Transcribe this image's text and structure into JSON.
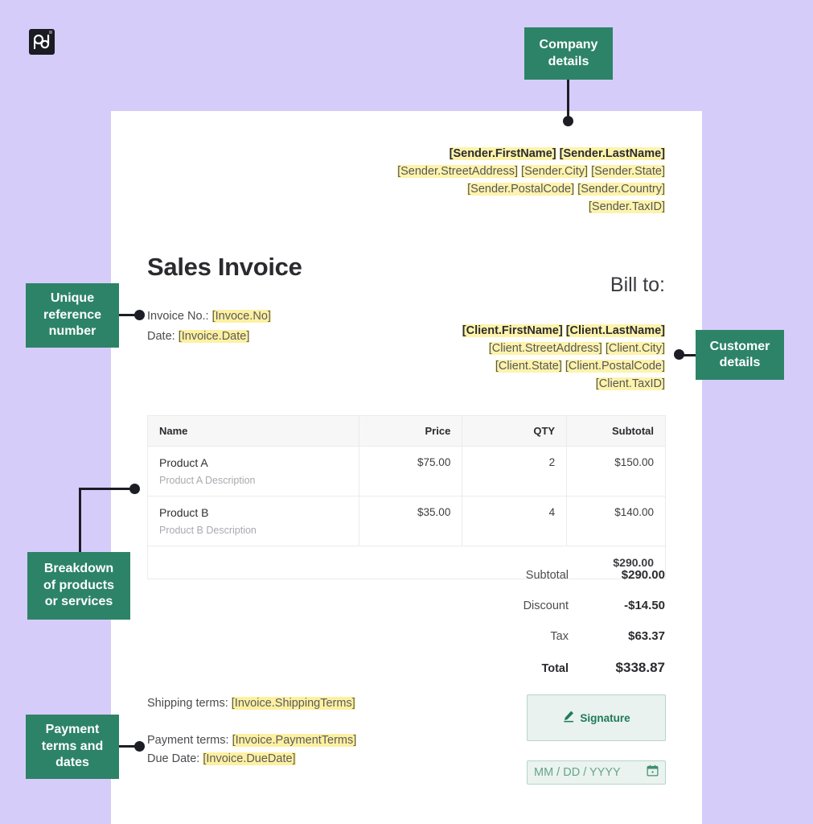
{
  "brand": {
    "logo_name": "pandadoc-logo",
    "background_color": "#d6ccfa",
    "accent_color": "#2d8367",
    "highlight_color": "#fdf3ab"
  },
  "callouts": [
    {
      "id": "company",
      "label": "Company\ndetails",
      "line1": "Company",
      "line2": "details",
      "line3": ""
    },
    {
      "id": "unique",
      "label": "Unique reference number",
      "line1": "Unique",
      "line2": "reference",
      "line3": "number"
    },
    {
      "id": "breakdown",
      "label": "Breakdown of products or services",
      "line1": "Breakdown",
      "line2": "of products",
      "line3": "or services"
    },
    {
      "id": "payment",
      "label": "Payment terms and dates",
      "line1": "Payment",
      "line2": "terms and",
      "line3": "dates"
    },
    {
      "id": "customer",
      "label": "Customer details",
      "line1": "Customer",
      "line2": "details",
      "line3": ""
    }
  ],
  "sender": {
    "name_first": "[Sender.FirstName]",
    "name_last": "[Sender.LastName]",
    "street": "[Sender.StreetAddress]",
    "city": "[Sender.City]",
    "state": "[Sender.State]",
    "postal": "[Sender.PostalCode]",
    "country": "[Sender.Country]",
    "taxid": "[Sender.TaxID]"
  },
  "invoice": {
    "title": "Sales Invoice",
    "number_label": "Invoice No.:",
    "number_value": "[Invoce.No]",
    "date_label": "Date:",
    "date_value": "[Invoice.Date]"
  },
  "bill_to": {
    "heading": "Bill to:",
    "name_first": "[Client.FirstName]",
    "name_last": "[Client.LastName]",
    "street": "[Client.StreetAddress]",
    "city": "[Client.City]",
    "state": "[Client.State]",
    "postal": "[Client.PostalCode]",
    "taxid": "[Client.TaxID]"
  },
  "table": {
    "columns": [
      "Name",
      "Price",
      "QTY",
      "Subtotal"
    ],
    "rows": [
      {
        "name": "Product A",
        "description": "Product A Description",
        "price": "$75.00",
        "qty": "2",
        "subtotal": "$150.00"
      },
      {
        "name": "Product B",
        "description": "Product B Description",
        "price": "$35.00",
        "qty": "4",
        "subtotal": "$140.00"
      }
    ],
    "footer_total": "$290.00"
  },
  "totals": [
    {
      "label": "Subtotal",
      "value": "$290.00"
    },
    {
      "label": "Discount",
      "value": "-$14.50"
    },
    {
      "label": "Tax",
      "value": "$63.37"
    },
    {
      "label": "Total",
      "value": "$338.87"
    }
  ],
  "terms": {
    "shipping_label": "Shipping terms:",
    "shipping_value": "[Invoice.ShippingTerms]",
    "payment_label": "Payment terms:",
    "payment_value": "[Invoice.PaymentTerms]",
    "due_label": "Due Date:",
    "due_value": "[Invoice.DueDate]"
  },
  "signature": {
    "button_label": "Signature",
    "date_placeholder": "MM / DD / YYYY"
  }
}
